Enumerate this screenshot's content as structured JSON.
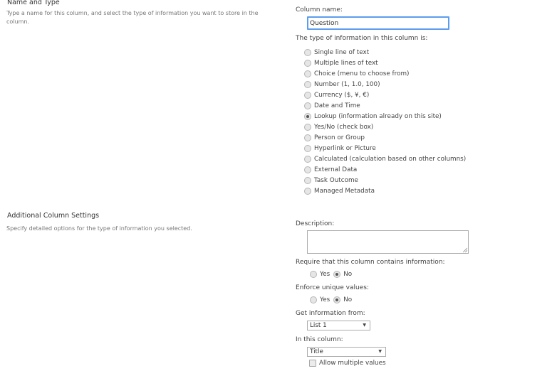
{
  "name_and_type": {
    "title": "Name and Type",
    "description": "Type a name for this column, and select the type of information you want to store in the column."
  },
  "column_name": {
    "label": "Column name:",
    "value": "Question"
  },
  "type_of_info": {
    "label": "The type of information in this column is:",
    "options": [
      {
        "label": "Single line of text",
        "checked": false
      },
      {
        "label": "Multiple lines of text",
        "checked": false
      },
      {
        "label": "Choice (menu to choose from)",
        "checked": false
      },
      {
        "label": "Number (1, 1.0, 100)",
        "checked": false
      },
      {
        "label": "Currency ($, ¥, €)",
        "checked": false
      },
      {
        "label": "Date and Time",
        "checked": false
      },
      {
        "label": "Lookup (information already on this site)",
        "checked": true
      },
      {
        "label": "Yes/No (check box)",
        "checked": false
      },
      {
        "label": "Person or Group",
        "checked": false
      },
      {
        "label": "Hyperlink or Picture",
        "checked": false
      },
      {
        "label": "Calculated (calculation based on other columns)",
        "checked": false
      },
      {
        "label": "External Data",
        "checked": false
      },
      {
        "label": "Task Outcome",
        "checked": false
      },
      {
        "label": "Managed Metadata",
        "checked": false
      }
    ]
  },
  "additional_settings": {
    "title": "Additional Column Settings",
    "description": "Specify detailed options for the type of information you selected."
  },
  "description_field": {
    "label": "Description:",
    "value": ""
  },
  "require_info": {
    "label": "Require that this column contains information:",
    "yes_label": "Yes",
    "no_label": "No",
    "selected": "No"
  },
  "enforce_unique": {
    "label": "Enforce unique values:",
    "yes_label": "Yes",
    "no_label": "No",
    "selected": "No"
  },
  "get_info_from": {
    "label": "Get information from:",
    "selected": "List 1"
  },
  "in_this_column": {
    "label": "In this column:",
    "selected": "Title"
  },
  "allow_multiple": {
    "label": "Allow multiple values",
    "checked": false
  },
  "icons": {
    "dropdown_arrow": "▼"
  }
}
